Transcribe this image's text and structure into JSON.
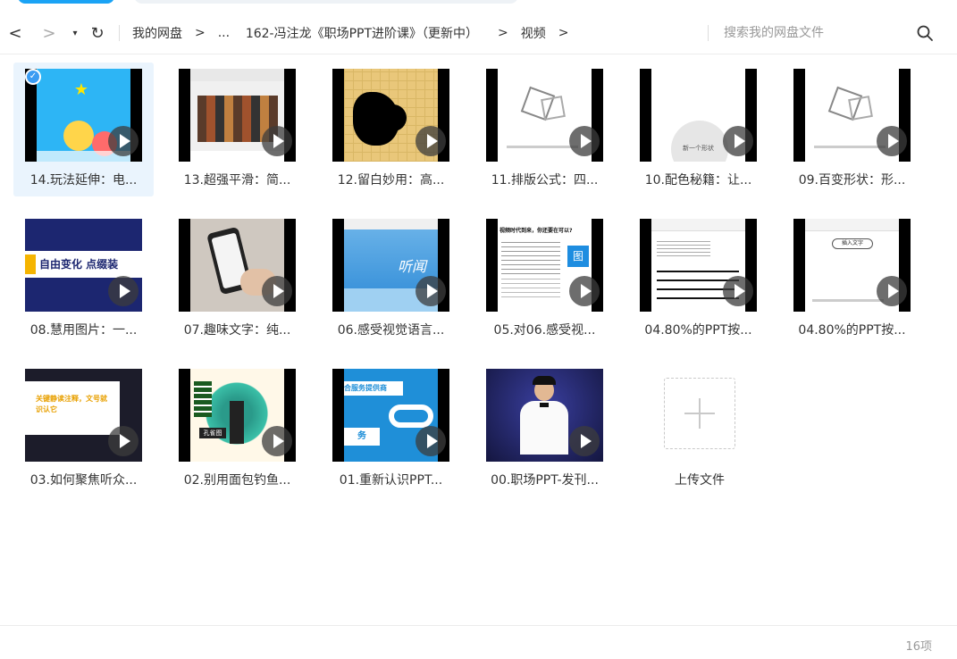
{
  "window": {
    "accent_color": "#1aa3f5"
  },
  "toolbar": {
    "back_label": "<",
    "forward_label": ">",
    "dropdown_label": "▾",
    "refresh_label": "↻",
    "breadcrumb": [
      {
        "label": "我的网盘"
      },
      {
        "label": "..."
      },
      {
        "label": "162-冯注龙《职场PPT进阶课》（更新中）"
      },
      {
        "label": "视频"
      }
    ],
    "breadcrumb_separator": ">",
    "search_placeholder": "搜索我的网盘文件",
    "search_value": ""
  },
  "files": [
    {
      "name": "14.玩法延伸：电...",
      "type": "video",
      "selected": true
    },
    {
      "name": "13.超强平滑：简...",
      "type": "video",
      "selected": false
    },
    {
      "name": "12.留白妙用：高...",
      "type": "video",
      "selected": false
    },
    {
      "name": "11.排版公式：四...",
      "type": "video",
      "selected": false
    },
    {
      "name": "10.配色秘籍：让...",
      "type": "video",
      "selected": false
    },
    {
      "name": "09.百变形状：形...",
      "type": "video",
      "selected": false
    },
    {
      "name": "08.慧用图片：一...",
      "type": "video",
      "selected": false
    },
    {
      "name": "07.趣味文字：纯...",
      "type": "video",
      "selected": false
    },
    {
      "name": "06.感受视觉语言...",
      "type": "video",
      "selected": false
    },
    {
      "name": "05.对06.感受视...",
      "type": "video",
      "selected": false
    },
    {
      "name": "04.80%的PPT按...",
      "type": "video",
      "selected": false
    },
    {
      "name": "04.80%的PPT按...",
      "type": "video",
      "selected": false
    },
    {
      "name": "03.如何聚焦听众...",
      "type": "video",
      "selected": false
    },
    {
      "name": "02.别用面包钓鱼...",
      "type": "video",
      "selected": false
    },
    {
      "name": "01.重新认识PPT...",
      "type": "video",
      "selected": false
    },
    {
      "name": "00.职场PPT-发刊...",
      "type": "video",
      "selected": false
    }
  ],
  "upload": {
    "label": "上传文件"
  },
  "thumb_text": {
    "t08": "自由变化  点缀装",
    "t06": "听闻",
    "t05_title": "视频时代到来，你还要在可以?",
    "t05_side": "图",
    "t04_tag": "插入文字",
    "t03": "关键静读注释，文号就识认它",
    "t02_tag": "孔雀图",
    "t01_top": "合服务提供商",
    "t01_bottom": "务",
    "t10_label": "新一个形状"
  },
  "status": {
    "count_label": "16项"
  }
}
